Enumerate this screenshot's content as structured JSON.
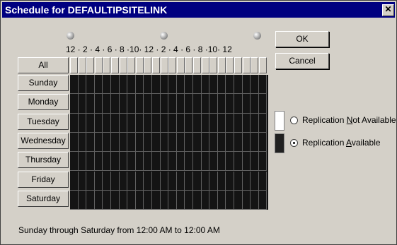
{
  "window": {
    "title": "Schedule for DEFAULTIPSITELINK",
    "close_label": "✕"
  },
  "time_ticks": "12 · 2 · 4 · 6 · 8 ·10· 12 · 2 · 4 · 6 · 8 ·10· 12",
  "all_label": "All",
  "days": [
    "Sunday",
    "Monday",
    "Tuesday",
    "Wednesday",
    "Thursday",
    "Friday",
    "Saturday"
  ],
  "buttons": {
    "ok": "OK",
    "cancel": "Cancel"
  },
  "legend": {
    "not_available": {
      "pre": "Replication ",
      "key": "N",
      "post": "ot Available",
      "color": "#ffffff"
    },
    "available": {
      "pre": "Replication ",
      "key": "A",
      "post": "vailable",
      "color": "#202020"
    },
    "selected": "available"
  },
  "status_text": "Sunday through Saturday from 12:00 AM to 12:00 AM"
}
